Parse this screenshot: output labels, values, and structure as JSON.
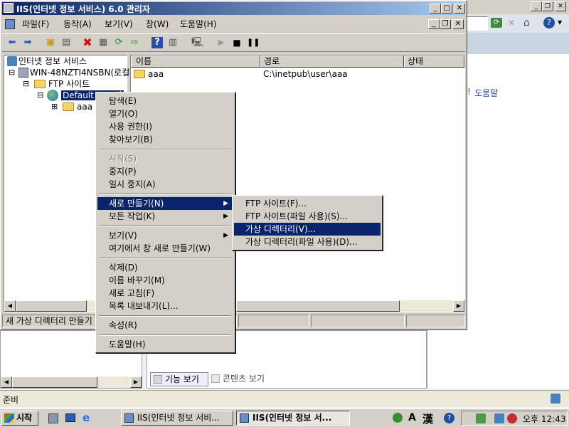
{
  "background_window": {
    "help_text": "도움말",
    "help_fragment": "!"
  },
  "main_window": {
    "title": "IIS(인터넷 정보 서비스) 6.0 관리자",
    "menus": [
      "파일(F)",
      "동작(A)",
      "보기(V)",
      "창(W)",
      "도움말(H)"
    ],
    "status": "새 가상 디렉터리 만들기"
  },
  "tree": {
    "root": "인터넷 정보 서비스",
    "server": "WIN-48NZTI4NSBN(로컬",
    "ftp_sites": "FTP 사이트",
    "default_site": "Default FTP 사",
    "child": "aaa",
    "expander_minus": "⊟",
    "expander_plus": "⊞"
  },
  "list": {
    "columns": [
      "이름",
      "경로",
      "상태"
    ],
    "rows": [
      {
        "name": "aaa",
        "path": "C:\\inetpub\\user\\aaa",
        "status": ""
      }
    ]
  },
  "context_menu": {
    "items": [
      {
        "label": "탐색(E)",
        "enabled": true
      },
      {
        "label": "열기(O)",
        "enabled": true
      },
      {
        "label": "사용 권한(I)",
        "enabled": true
      },
      {
        "label": "찾아보기(B)",
        "enabled": true
      },
      {
        "label": "시작(S)",
        "enabled": false
      },
      {
        "label": "중지(P)",
        "enabled": true
      },
      {
        "label": "일시 중지(A)",
        "enabled": true
      },
      {
        "label": "새로 만들기(N)",
        "enabled": true,
        "highlight": true,
        "submenu": true
      },
      {
        "label": "모든 작업(K)",
        "enabled": true,
        "submenu": true
      },
      {
        "label": "보기(V)",
        "enabled": true,
        "submenu": true
      },
      {
        "label": "여기에서 창 새로 만들기(W)",
        "enabled": true
      },
      {
        "label": "삭제(D)",
        "enabled": true
      },
      {
        "label": "이름 바꾸기(M)",
        "enabled": true
      },
      {
        "label": "새로 고침(F)",
        "enabled": true
      },
      {
        "label": "목록 내보내기(L)...",
        "enabled": true
      },
      {
        "label": "속성(R)",
        "enabled": true
      },
      {
        "label": "도움말(H)",
        "enabled": true
      }
    ]
  },
  "submenu": {
    "items": [
      {
        "label": "FTP 사이트(F)..."
      },
      {
        "label": "FTP 사이트(파일 사용)(S)..."
      },
      {
        "label": "가상 디렉터리(V)...",
        "highlight": true
      },
      {
        "label": "가상 디렉터리(파일 사용)(D)..."
      }
    ]
  },
  "lower_tabs": {
    "feature_view": "기능 보기",
    "content_view": "콘텐츠 보기"
  },
  "bottom_status": "준비",
  "taskbar": {
    "start": "시작",
    "tasks": [
      {
        "label": "IIS(인터넷 정보 서비...",
        "active": false
      },
      {
        "label": "IIS(인터넷 정보 서...",
        "active": true
      }
    ],
    "ime_a": "A",
    "ime_han": "漢",
    "clock": "오후 12:43"
  },
  "colors": {
    "title_active": "#0a246a",
    "title_gradient": "#a6caf0",
    "highlight": "#0a246a",
    "face": "#d4d0c8"
  }
}
